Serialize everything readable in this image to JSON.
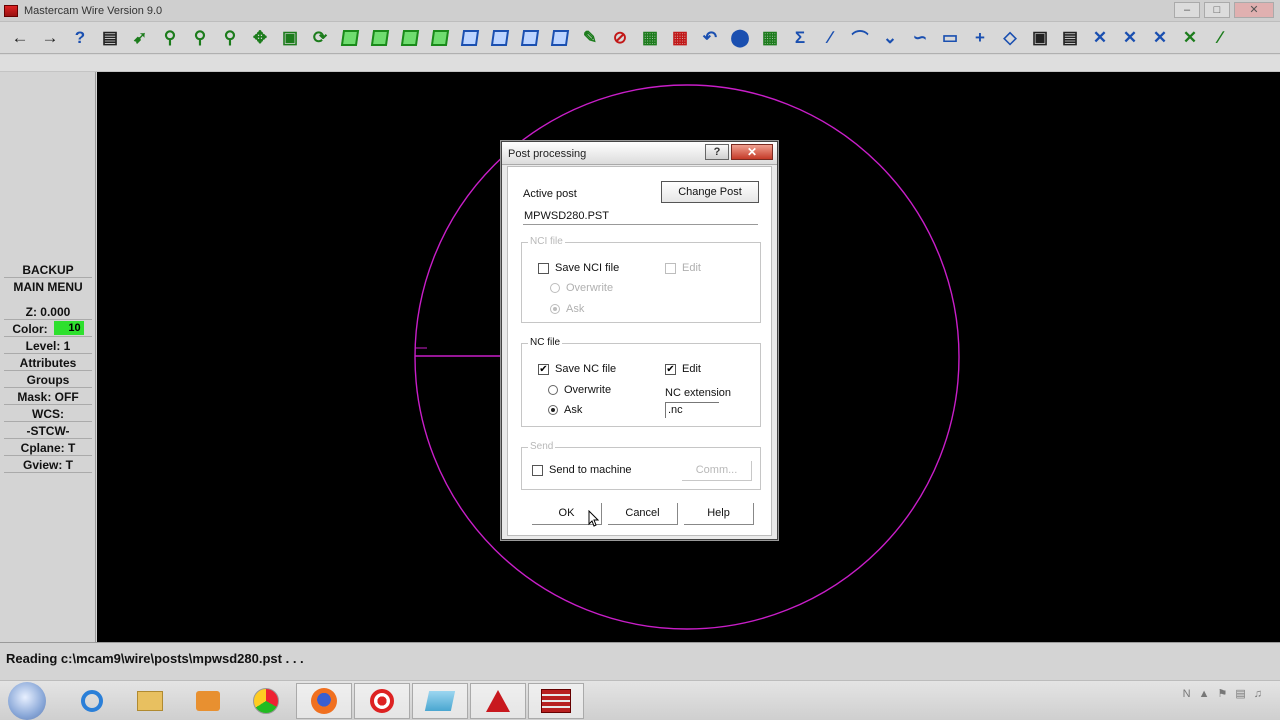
{
  "window": {
    "title": "Mastercam Wire Version 9.0",
    "controls": [
      "–",
      "□",
      "✕"
    ]
  },
  "toolbar": {
    "icons": [
      "back-arrow-icon",
      "forward-arrow-icon",
      "help-question-icon",
      "file-icon",
      "analyze-icon",
      "zoom-window-icon",
      "zoom-out-icon",
      "zoom-fit-icon",
      "pan-icon",
      "select-icon",
      "rotate-icon",
      "cube-view-1-icon",
      "cube-view-2-icon",
      "cube-view-3-icon",
      "cube-view-4-icon",
      "cube-view-5-icon",
      "cube-view-6-icon",
      "cube-view-7-icon",
      "cube-view-8-icon",
      "pencil-icon",
      "no-entry-icon",
      "transform-1-icon",
      "transform-2-icon",
      "undo-icon",
      "sphere-icon",
      "grid-icon",
      "sigma-icon",
      "line-icon",
      "arc-icon",
      "trim-icon",
      "spline-icon",
      "rectangle-icon",
      "point-icon",
      "mesh-icon",
      "solid-box-icon",
      "stack-icon",
      "wire-1-icon",
      "wire-2-icon",
      "wire-3-icon",
      "wire-4-icon",
      "wire-5-icon"
    ]
  },
  "menu": {
    "backup": "BACKUP",
    "main_menu": "MAIN MENU",
    "z": "Z:  0.000",
    "color_label": "Color:",
    "color_value": "10",
    "color_swatch": "#2ee02e",
    "level": "Level:  1",
    "attributes": "Attributes",
    "groups": "Groups",
    "mask": "Mask:  OFF",
    "wcs": "WCS:",
    "stcw": "-STCW-",
    "cplane": "Cplane:  T",
    "gview": "Gview:  T"
  },
  "canvas": {
    "background": "#000000",
    "geometry_color": "#c81ec8"
  },
  "status": {
    "text": "Reading c:\\mcam9\\wire\\posts\\mpwsd280.pst . . ."
  },
  "dialog": {
    "title": "Post processing",
    "help_btn": "?",
    "close_btn": "✕",
    "active_post_label": "Active post",
    "change_post_btn": "Change Post",
    "active_post_value": "MPWSD280.PST",
    "nci_group": "NCI file",
    "save_nci": "Save NCI file",
    "nci_edit": "Edit",
    "nci_overwrite": "Overwrite",
    "nci_ask": "Ask",
    "nc_group": "NC file",
    "save_nc": "Save NC file",
    "nc_edit": "Edit",
    "nc_overwrite": "Overwrite",
    "nc_ask": "Ask",
    "nc_extension_label": "NC extension",
    "nc_extension_value": ".nc",
    "send_group": "Send",
    "send_to_machine": "Send to machine",
    "comm_btn": "Comm...",
    "ok_btn": "OK",
    "cancel_btn": "Cancel",
    "help_bottom_btn": "Help",
    "checks": {
      "save_nci": false,
      "nci_edit": false,
      "save_nc": true,
      "nc_edit": true,
      "send_to_machine": false
    },
    "radios": {
      "nci": "ask",
      "nc": "ask"
    }
  },
  "taskbar": {
    "apps": [
      "start-orb-icon",
      "internet-explorer-icon",
      "folder-icon",
      "media-player-icon",
      "chrome-icon",
      "firefox-icon",
      "recorder-icon",
      "app-icon",
      "autocad-icon",
      "mastercam-icon"
    ],
    "tray_letter": "N"
  }
}
